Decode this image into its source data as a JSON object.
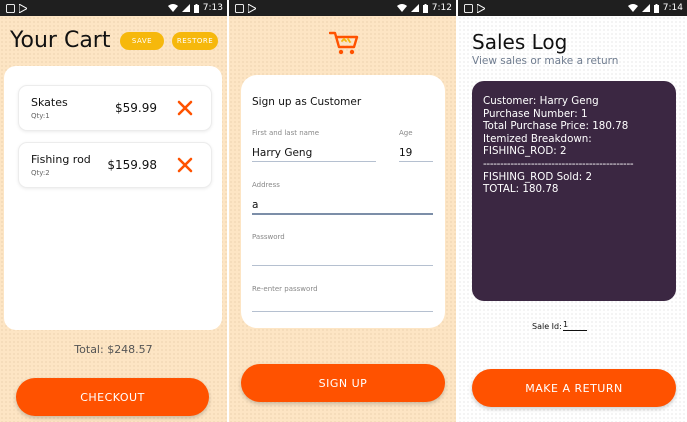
{
  "status_bars": [
    {
      "time": "7:13"
    },
    {
      "time": "7:12"
    },
    {
      "time": "7:14"
    }
  ],
  "cart": {
    "title": "Your Cart",
    "save_label": "SAVE",
    "restore_label": "RESTORE",
    "items": [
      {
        "name": "Skates",
        "qty": "Qty:1",
        "price": "$59.99"
      },
      {
        "name": "Fishing rod",
        "qty": "Qty:2",
        "price": "$159.98"
      }
    ],
    "total": "Total: $248.57",
    "checkout_label": "CHECKOUT"
  },
  "signup": {
    "heading": "Sign up as Customer",
    "name_label": "First and last name",
    "name_value": "Harry Geng",
    "age_label": "Age",
    "age_value": "19",
    "address_label": "Address",
    "address_value": "a",
    "password_label": "Password",
    "password_value": "",
    "reenter_label": "Re-enter password",
    "reenter_value": "",
    "signup_label": "SIGN UP"
  },
  "sales": {
    "title": "Sales Log",
    "subtitle": "View sales or make a return",
    "log_lines": [
      "Customer: Harry Geng",
      "Purchase Number: 1",
      "Total Purchase Price: 180.78",
      "Itemized Breakdown:",
      "FISHING_ROD: 2",
      "--------------------------------------------",
      "FISHING_ROD Sold: 2",
      "TOTAL: 180.78"
    ],
    "sale_id_label": "Sale Id:",
    "sale_id_value": "1",
    "return_label": "MAKE A RETURN"
  },
  "colors": {
    "accent_orange": "#ff5200",
    "pill_yellow": "#f6b80c",
    "panel_purple": "#3b2742",
    "background_peach": "#fde5c4"
  },
  "icons": [
    "play-store-icon",
    "wifi-icon",
    "signal-icon",
    "battery-icon",
    "close-icon",
    "shopping-cart-icon"
  ]
}
